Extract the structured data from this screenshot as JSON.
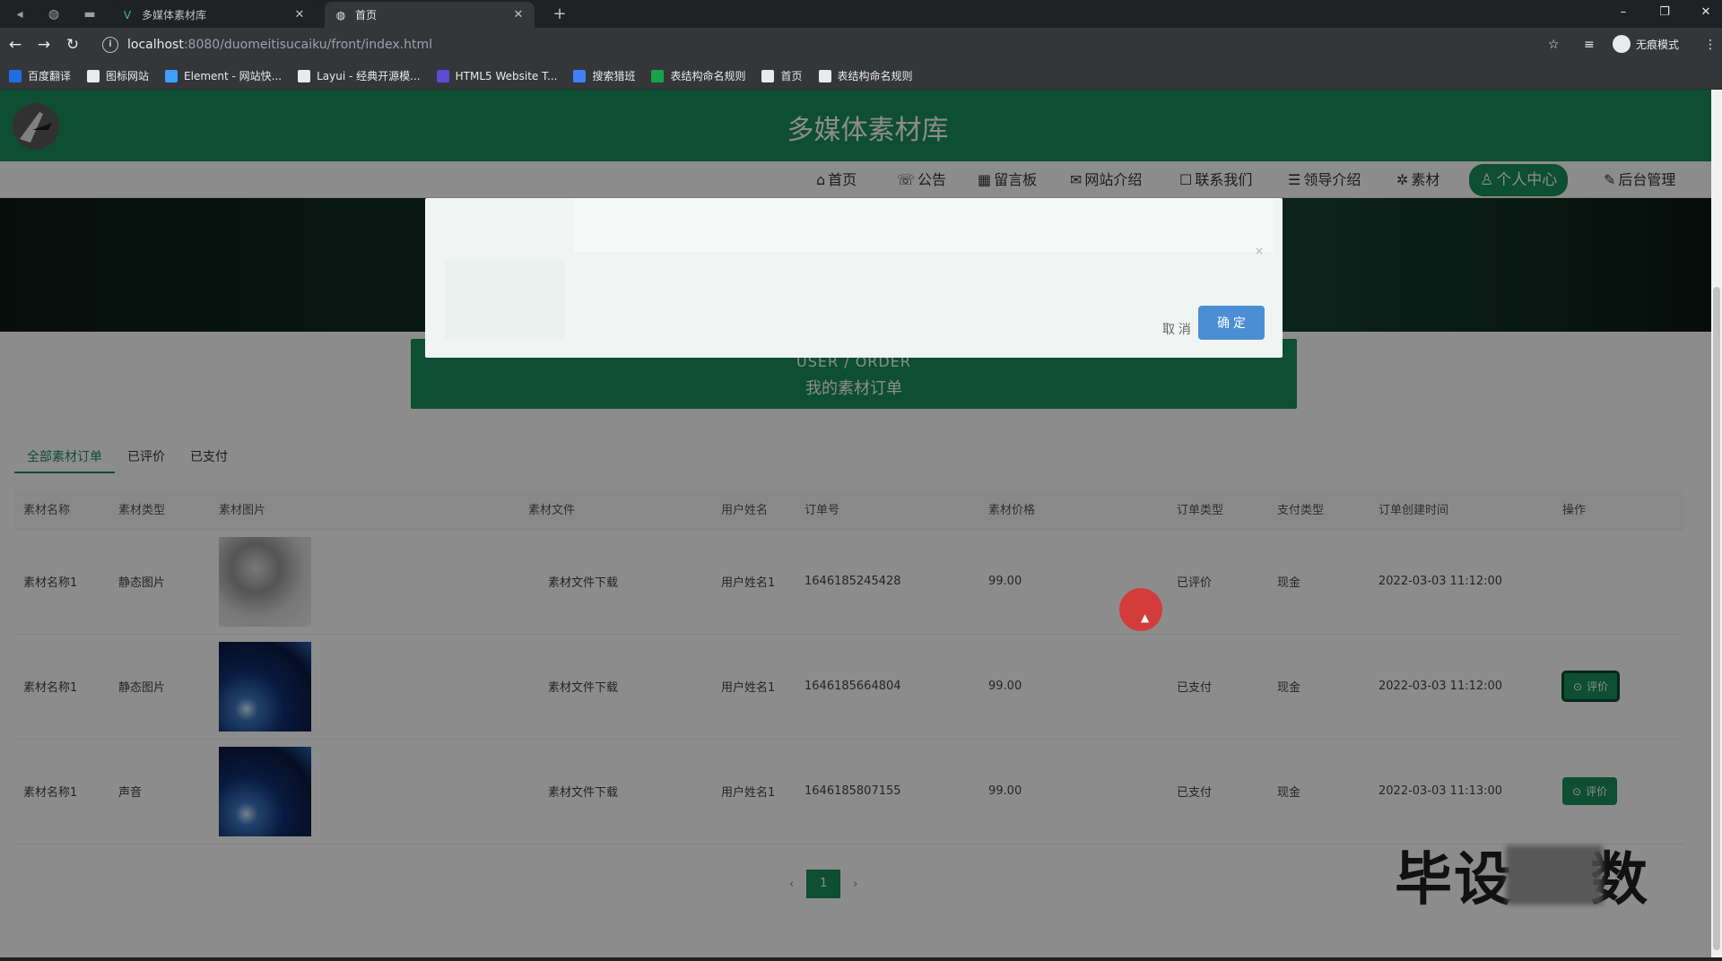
{
  "browser": {
    "tabs": [
      {
        "title": "多媒体素材库",
        "active": false
      },
      {
        "title": "首页",
        "active": true
      }
    ],
    "address": {
      "host": "localhost",
      "path": ":8080/duomeitisucaiku/front/index.html"
    },
    "profile_label": "无痕模式",
    "bookmarks": [
      {
        "label": "百度翻译",
        "color": "#1e6ee6"
      },
      {
        "label": "图标网站",
        "color": "#e8eaed"
      },
      {
        "label": "Element - 网站快...",
        "color": "#409eff"
      },
      {
        "label": "Layui - 经典开源模...",
        "color": "#e8eaed"
      },
      {
        "label": "HTML5 Website T...",
        "color": "#5b4bd6"
      },
      {
        "label": "搜索猎班",
        "color": "#4080ff"
      },
      {
        "label": "表结构命名规则",
        "color": "#16a34a"
      },
      {
        "label": "首页",
        "color": "#e8eaed"
      },
      {
        "label": "表结构命名规则",
        "color": "#e8eaed"
      }
    ]
  },
  "site": {
    "title": "多媒体素材库",
    "nav": [
      {
        "icon": "⌂",
        "label": "首页",
        "active": false
      },
      {
        "icon": "☏",
        "label": "公告",
        "active": false
      },
      {
        "icon": "▦",
        "label": "留言板",
        "active": false
      },
      {
        "icon": "✉",
        "label": "网站介绍",
        "active": false
      },
      {
        "icon": "☐",
        "label": "联系我们",
        "active": false
      },
      {
        "icon": "☰",
        "label": "领导介绍",
        "active": false
      },
      {
        "icon": "✲",
        "label": "素材",
        "active": false
      },
      {
        "icon": "♙",
        "label": "个人中心",
        "active": true
      },
      {
        "icon": "✎",
        "label": "后台管理",
        "active": false
      }
    ]
  },
  "order_header": {
    "en": "USER / ORDER",
    "cn": "我的素材订单"
  },
  "filter_tabs": [
    "全部素材订单",
    "已评价",
    "已支付"
  ],
  "table": {
    "columns": [
      "素材名称",
      "素材类型",
      "素材图片",
      "素材文件",
      "用户姓名",
      "订单号",
      "素材价格",
      "订单类型",
      "支付类型",
      "订单创建时间",
      "操作"
    ],
    "rows": [
      {
        "name": "素材名称1",
        "type": "静态图片",
        "image": "doc",
        "file": "素材文件下载",
        "user": "用户姓名1",
        "order_no": "1646185245428",
        "price": "99.00",
        "order_type": "已评价",
        "pay_type": "现金",
        "created": "2022-03-03 11:12:00",
        "action": ""
      },
      {
        "name": "素材名称1",
        "type": "静态图片",
        "image": "blue",
        "file": "素材文件下载",
        "user": "用户姓名1",
        "order_no": "1646185664804",
        "price": "99.00",
        "order_type": "已支付",
        "pay_type": "现金",
        "created": "2022-03-03 11:12:00",
        "action": "评价"
      },
      {
        "name": "素材名称1",
        "type": "声音",
        "image": "blue",
        "file": "素材文件下载",
        "user": "用户姓名1",
        "order_no": "1646185807155",
        "price": "99.00",
        "order_type": "已支付",
        "pay_type": "现金",
        "created": "2022-03-03 11:13:00",
        "action": "评价"
      }
    ]
  },
  "pager": {
    "prev": "‹",
    "current": "1",
    "next": "›"
  },
  "dialog": {
    "cancel": "取 消",
    "confirm": "确 定",
    "close": "×"
  },
  "watermark": {
    "prefix": "毕设",
    "suffix": "数"
  },
  "colors": {
    "brand": "#1a8f5e",
    "confirm": "#4a8fd4"
  }
}
